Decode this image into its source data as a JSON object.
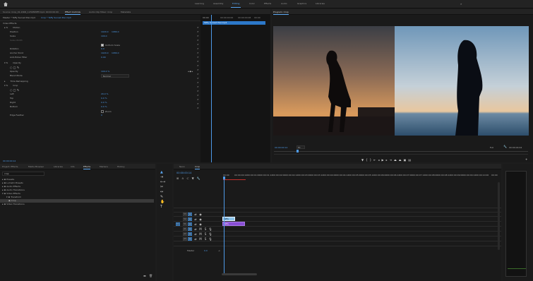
{
  "workspaces": [
    "Learning",
    "Assembly",
    "Editing",
    "Color",
    "Effects",
    "Audio",
    "Graphics",
    "Libraries"
  ],
  "active_workspace": "Editing",
  "source_tabs": {
    "source": "Source: Crop_01-2006_1234895fff.mp4: 00:00:00:00",
    "effect_controls": "Effect Controls",
    "audio_mixer": "Audio Clip Mixer: Crop",
    "metadata": "Metadata"
  },
  "ec": {
    "master": "Master * Taffy Sunset Pier.mp4",
    "clip": "Crop * Taffy Sunset Pier.mp4",
    "timecode_right": "00:00",
    "clip_label": "Taffy Sunset Pier.mp4",
    "video_effects": "Video Effects",
    "motion": "Motion",
    "position": "Position",
    "position_v1": "1920.0",
    "position_v2": "1080.0",
    "scale": "Scale",
    "scale_v": "100.0",
    "scale_width": "Scale Width",
    "uniform": "Uniform Scale",
    "rotation": "Rotation",
    "rotation_v": "0.0",
    "anchor": "Anchor Point",
    "anchor_v1": "1920.0",
    "anchor_v2": "1080.0",
    "antiflicker": "Anti-flicker Filter",
    "antiflicker_v": "0.00",
    "opacity": "Opacity",
    "opacity_sub": "Opacity",
    "opacity_v": "100.0 %",
    "blend": "Blend Mode",
    "blend_v": "Normal",
    "time_remap": "Time Remapping",
    "crop": "Crop",
    "left": "Left",
    "left_v": "29.0 %",
    "top": "Top",
    "top_v": "0.0 %",
    "right": "Right",
    "right_v": "0.0 %",
    "bottom": "Bottom",
    "bottom_v": "0.0 %",
    "zoom": "Zoom",
    "edge": "Edge Feather",
    "edge_v": "0",
    "timecode": "00:00:00:14"
  },
  "program": {
    "title": "Program: Crop",
    "timecode": "00:00:00:14",
    "fit": "Fit",
    "quality": "Full",
    "duration": "00:00:04:04"
  },
  "effects_panel": {
    "tabs": [
      "Project: Effects",
      "Media Browser",
      "Libraries",
      "Info",
      "Effects",
      "Markers",
      "History"
    ],
    "active": "Effects",
    "search": "crop",
    "items": [
      "Presets",
      "Lumetri Presets",
      "Audio Effects",
      "Audio Transitions",
      "Video Effects",
      "Transform",
      "Crop",
      "Video Transitions"
    ]
  },
  "timeline": {
    "tabs": [
      "Neon",
      "Crop"
    ],
    "timecode": "00:00:00:14",
    "ruler": [
      "00:00",
      "00:00:00:12",
      "00:00:01:00",
      "00:00:01:12",
      "00:00:02:00",
      "00:00:02:12",
      "00:00:03:00",
      "00:00:03:12",
      "00:00:04:00",
      "00:00:04:12",
      "00:00:05:00",
      "00:00:05:12",
      "00:00:06:00",
      "00:00:06:12",
      "00:00:07:00",
      "00:00:07:12",
      "00:00:08:00",
      "00:00:08:12",
      "00:00:09:00",
      "00:00:09:12",
      "00:00:10:00",
      "00:00"
    ],
    "tracks_v": [
      "V3",
      "V2",
      "V1"
    ],
    "tracks_a": [
      "A1",
      "A2",
      "A3"
    ],
    "master": "Master",
    "master_v": "0.0",
    "clip_v2": "Taffy",
    "clip_v1": "Taffy"
  },
  "colors": {
    "accent": "#5aa6f2",
    "clip_blue": "#2c78c9",
    "clip_purple": "#8a4fd6"
  }
}
